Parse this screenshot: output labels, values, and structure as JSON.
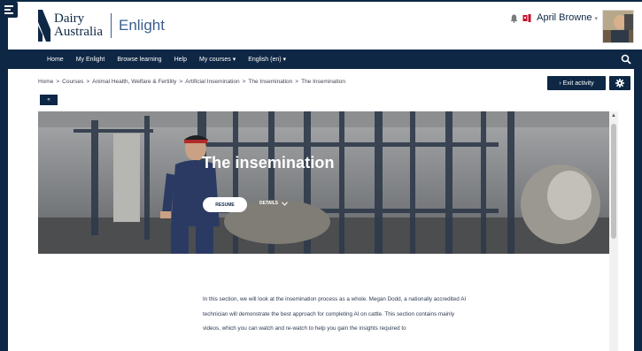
{
  "brand": {
    "name_line1": "Dairy",
    "name_line2": "Australia",
    "product": "Enlight"
  },
  "user": {
    "name": "April Browne",
    "caret": "▾"
  },
  "nav": {
    "items": [
      "Home",
      "My Enlight",
      "Browse learning",
      "Help",
      "My courses ▾",
      "English (en) ▾"
    ]
  },
  "breadcrumb": {
    "items": [
      "Home",
      "Courses",
      "Animal Health, Welfare & Fertility",
      "Artificial Insemination",
      "The Insemination",
      "The Insemination"
    ],
    "separator": ">"
  },
  "actions": {
    "exit_label": "› Exit activity",
    "small_nav_label": "«"
  },
  "hero": {
    "title": "The insemination",
    "resume_label": "RESUME",
    "details_label": "DETAILS"
  },
  "intro": {
    "text": "In this section, we will look at the insemination process as a whole. Megan Dodd, a nationally accredited AI technician will demonstrate the best approach for completing AI on cattle. This section contains mainly videos, which you can watch and re-watch to help you gain the insights required to"
  },
  "colors": {
    "navy": "#0e2745",
    "accent_blue": "#3a5f8f",
    "white": "#ffffff"
  },
  "icons": [
    "drawer-menu-icon",
    "bell-icon",
    "message-icon",
    "search-icon",
    "gear-icon",
    "chevron-down-icon"
  ]
}
